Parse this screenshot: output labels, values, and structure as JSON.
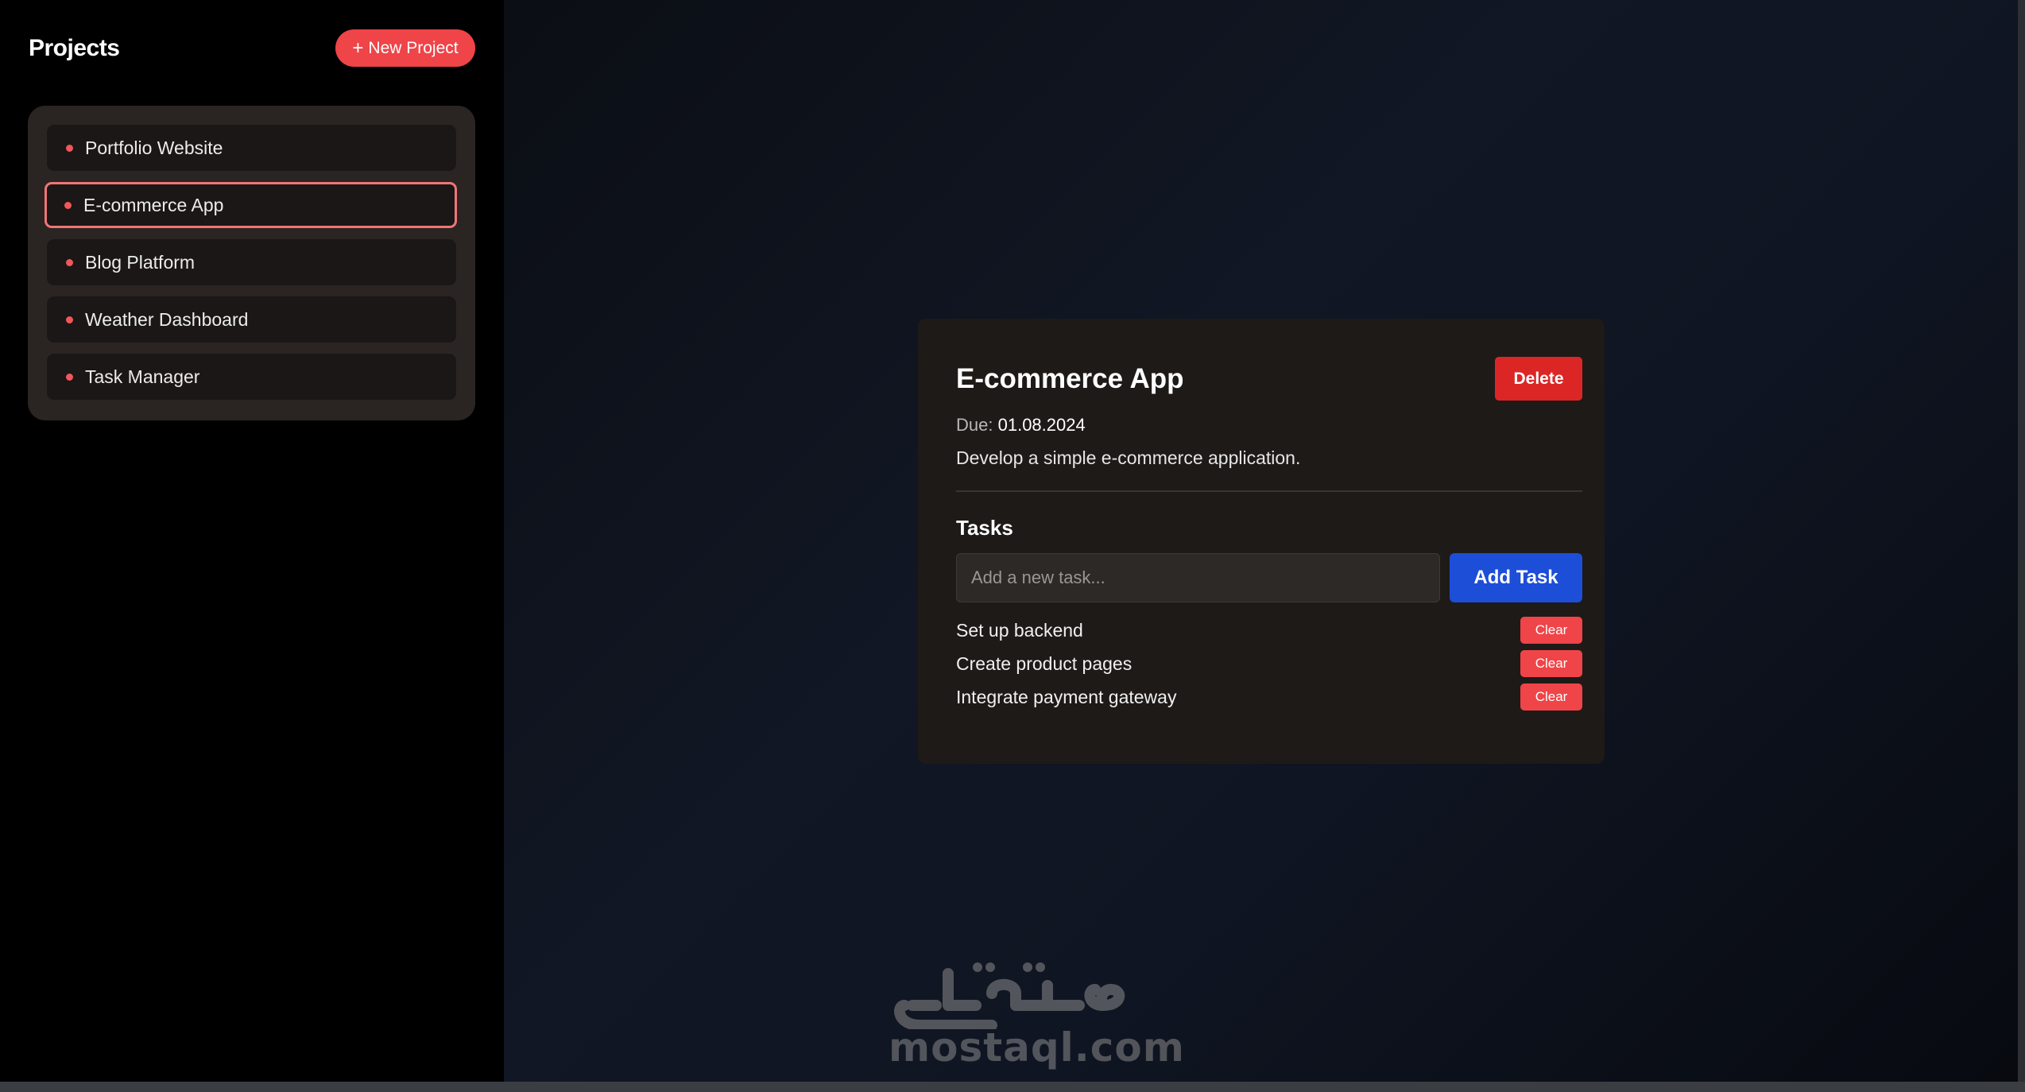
{
  "sidebar": {
    "title": "Projects",
    "new_project_plus": "+",
    "new_project_label": "New Project",
    "projects": [
      {
        "label": "Portfolio Website",
        "active": false
      },
      {
        "label": "E-commerce App",
        "active": true
      },
      {
        "label": "Blog Platform",
        "active": false
      },
      {
        "label": "Weather Dashboard",
        "active": false
      },
      {
        "label": "Task Manager",
        "active": false
      }
    ]
  },
  "project": {
    "title": "E-commerce App",
    "delete_label": "Delete",
    "due_label": "Due:",
    "due_value": "01.08.2024",
    "description": "Develop a simple e-commerce application."
  },
  "tasks": {
    "heading": "Tasks",
    "input_placeholder": "Add a new task...",
    "input_value": "",
    "add_label": "Add Task",
    "clear_label": "Clear",
    "items": [
      {
        "text": "Set up backend"
      },
      {
        "text": "Create product pages"
      },
      {
        "text": "Integrate payment gateway"
      }
    ]
  },
  "watermark": {
    "arabic": "مستقل",
    "text": "mostaql.com"
  },
  "colors": {
    "accent": "#ef4448",
    "delete": "#dc2626",
    "primary": "#1d4ed8",
    "active_border": "#f07577"
  }
}
